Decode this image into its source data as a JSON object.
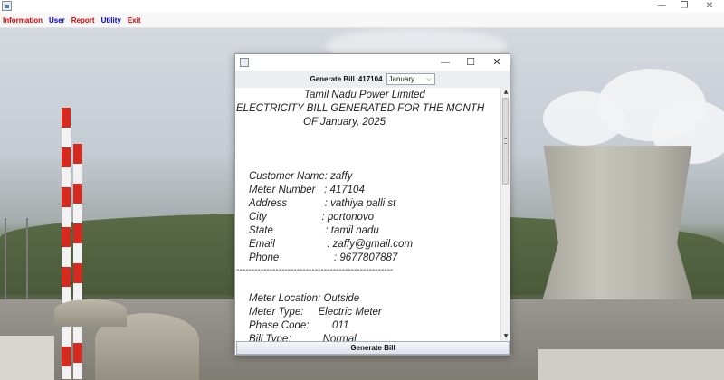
{
  "window": {
    "minimize": "—",
    "maximize": "❐",
    "close": "✕"
  },
  "menu": [
    {
      "label": "Information",
      "color": "#d40000"
    },
    {
      "label": "User",
      "color": "#0000cc"
    },
    {
      "label": "Report",
      "color": "#d40000"
    },
    {
      "label": "Utility",
      "color": "#0000cc"
    },
    {
      "label": "Exit",
      "color": "#d40000"
    }
  ],
  "dialog": {
    "controls": {
      "minimize": "—",
      "maximize": "☐",
      "close": "✕"
    },
    "header": {
      "label": "Generate Bill",
      "meter_number": "417104",
      "month": "January",
      "month_chevron": "⌵"
    },
    "bill": {
      "company": "Tamil Nadu Power Limited",
      "heading_line1": "ELECTRICITY BILL GENERATED FOR THE MONTH",
      "heading_line2": "OF January, 2025",
      "customer_name": "Customer Name: zaffy",
      "meter_number": "Meter Number   : 417104",
      "address": "Address             : vathiya palli st",
      "city": "City                   : portonovo",
      "state": "State                  : tamil nadu",
      "email": "Email                  : zaffy@gmail.com",
      "phone": "Phone                   : 9677807887",
      "separator": "----------------------------------------------------",
      "meter_location": "Meter Location: Outside",
      "meter_type": "Meter Type:     Electric Meter",
      "phase_code": "Phase Code:        011",
      "bill_type": "Bill Type:           Normal"
    },
    "scroll_position": 0,
    "generate_button": "Generate Bill"
  }
}
